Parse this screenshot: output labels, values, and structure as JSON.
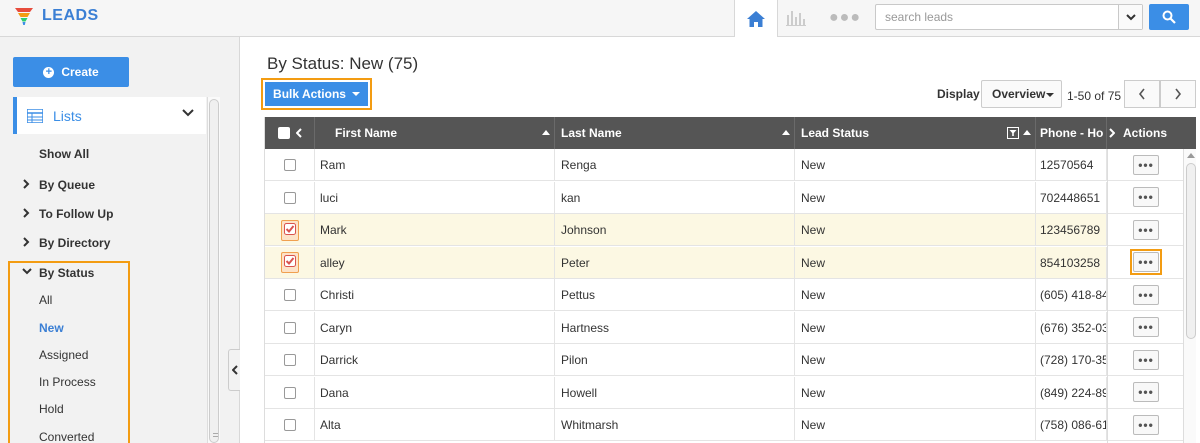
{
  "app": {
    "title": "LEADS",
    "accent": "#3b8ee6",
    "highlight": "#f39c12"
  },
  "topbar": {
    "search_placeholder": "search leads",
    "icons": [
      "home-icon",
      "chart-icon",
      "more-dots-icon",
      "search-icon"
    ]
  },
  "sidebar": {
    "create_label": "Create",
    "lists_label": "Lists",
    "nav": [
      {
        "label": "Show All"
      },
      {
        "label": "By Queue"
      },
      {
        "label": "To Follow Up"
      },
      {
        "label": "By Directory"
      },
      {
        "label": "By Status"
      }
    ],
    "status_items": [
      {
        "label": "All"
      },
      {
        "label": "New",
        "active": true
      },
      {
        "label": "Assigned"
      },
      {
        "label": "In Process"
      },
      {
        "label": "Hold"
      },
      {
        "label": "Converted"
      }
    ]
  },
  "main": {
    "title": "By Status: New (75)",
    "bulk_label": "Bulk Actions",
    "display_label": "Display",
    "display_value": "Overview",
    "pager": "1-50 of 75"
  },
  "table": {
    "columns": [
      "First Name",
      "Last Name",
      "Lead Status",
      "Phone - Ho",
      "Actions"
    ],
    "rows": [
      {
        "first": "Ram",
        "last": "Renga",
        "status": "New",
        "phone": "12570564",
        "checked": false
      },
      {
        "first": "luci",
        "last": "kan",
        "status": "New",
        "phone": "702448651",
        "checked": false
      },
      {
        "first": "Mark",
        "last": "Johnson",
        "status": "New",
        "phone": "123456789",
        "checked": true
      },
      {
        "first": "alley",
        "last": "Peter",
        "status": "New",
        "phone": "854103258",
        "checked": true
      },
      {
        "first": "Christi",
        "last": "Pettus",
        "status": "New",
        "phone": "(605) 418-84",
        "checked": false
      },
      {
        "first": "Caryn",
        "last": "Hartness",
        "status": "New",
        "phone": "(676) 352-03",
        "checked": false
      },
      {
        "first": "Darrick",
        "last": "Pilon",
        "status": "New",
        "phone": "(728) 170-35",
        "checked": false
      },
      {
        "first": "Dana",
        "last": "Howell",
        "status": "New",
        "phone": "(849) 224-89",
        "checked": false
      },
      {
        "first": "Alta",
        "last": "Whitmarsh",
        "status": "New",
        "phone": "(758) 086-61",
        "checked": false
      }
    ]
  }
}
